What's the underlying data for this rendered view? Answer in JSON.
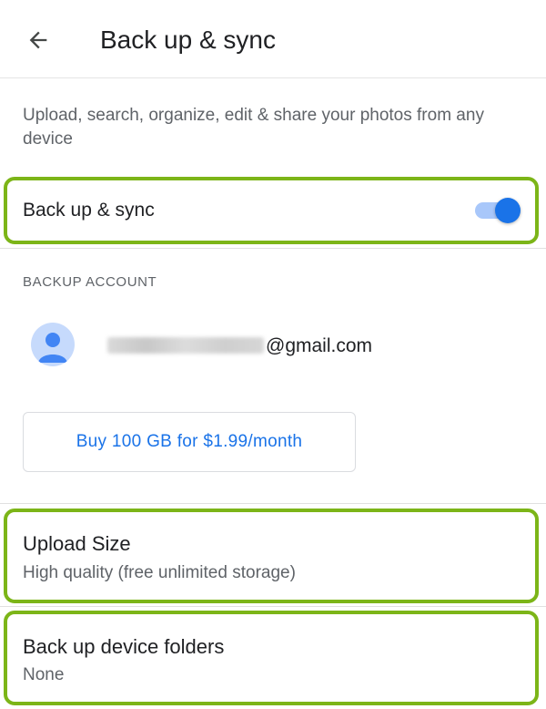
{
  "toolbar": {
    "title": "Back up & sync",
    "back_icon": "arrow-back-icon"
  },
  "description": "Upload, search, organize, edit & share your photos from any device",
  "backup_toggle": {
    "label": "Back up & sync",
    "enabled": true
  },
  "backup_account": {
    "header": "BACKUP ACCOUNT",
    "email_suffix": "@gmail.com",
    "avatar_icon": "person-icon"
  },
  "buy_button": {
    "label": "Buy 100 GB for $1.99/month"
  },
  "settings": {
    "upload_size": {
      "title": "Upload Size",
      "value": "High quality (free unlimited storage)"
    },
    "device_folders": {
      "title": "Back up device folders",
      "value": "None"
    }
  },
  "colors": {
    "accent": "#1a73e8",
    "highlight": "#7cb518",
    "toggle_track": "#a8c7fa"
  }
}
